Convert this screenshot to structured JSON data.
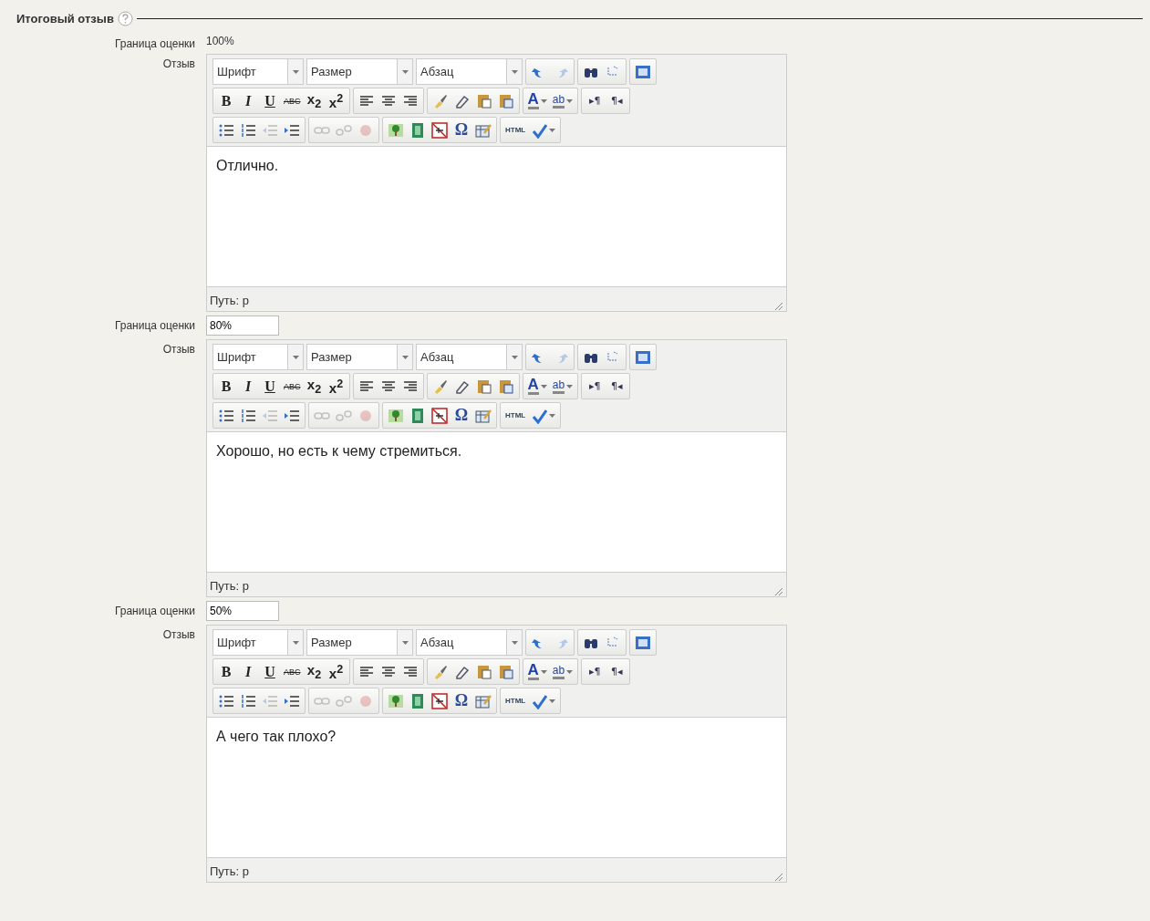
{
  "section": {
    "title": "Итоговый отзыв"
  },
  "entries": [
    {
      "grade": {
        "label": "Граница оценки",
        "value": "100%",
        "editable": false
      },
      "feedback": {
        "label": "Отзыв",
        "text": "Отлично.",
        "path": "Путь: p"
      },
      "toolbar": [
        [
          {
            "kind": "select",
            "label": "Шрифт"
          },
          {
            "kind": "select",
            "label": "Размер"
          },
          {
            "kind": "select",
            "label": "Абзац"
          },
          [
            {
              "kind": "icon",
              "disabled": false
            },
            {
              "kind": "icon",
              "disabled": true
            }
          ],
          [
            {
              "kind": "icon",
              "disabled": false
            },
            {
              "kind": "icon",
              "disabled": false
            }
          ],
          [
            {
              "kind": "icon",
              "disabled": false
            }
          ]
        ],
        [
          [
            {
              "kind": "text",
              "label": "B"
            },
            {
              "kind": "text",
              "label": "I"
            },
            {
              "kind": "text",
              "label": "U"
            },
            {
              "kind": "text",
              "label": "ABC"
            },
            {
              "kind": "text",
              "label": "x$_{2}$"
            },
            {
              "kind": "text",
              "label": "x$^{2}$"
            }
          ],
          [
            {
              "kind": "icon",
              "disabled": false
            },
            {
              "kind": "icon",
              "disabled": false
            },
            {
              "kind": "icon",
              "disabled": false
            }
          ],
          [
            {
              "kind": "icon",
              "disabled": false
            },
            {
              "kind": "icon",
              "disabled": false
            },
            {
              "kind": "icon",
              "disabled": false
            },
            {
              "kind": "icon",
              "disabled": false
            }
          ],
          [
            {
              "kind": "text",
              "label": "A",
              "split": true
            },
            {
              "kind": "text",
              "label": "ab",
              "split": true
            }
          ],
          [
            {
              "kind": "text",
              "label": "▸¶"
            },
            {
              "kind": "text",
              "label": "¶◂"
            }
          ]
        ],
        [
          [
            {
              "kind": "icon",
              "disabled": false
            },
            {
              "kind": "icon",
              "disabled": false
            },
            {
              "kind": "icon",
              "disabled": true
            },
            {
              "kind": "icon",
              "disabled": false
            }
          ],
          [
            {
              "kind": "icon",
              "disabled": true
            },
            {
              "kind": "icon",
              "disabled": true
            },
            {
              "kind": "icon",
              "disabled": true
            }
          ],
          [
            {
              "kind": "icon",
              "disabled": false
            },
            {
              "kind": "icon",
              "disabled": false
            },
            {
              "kind": "icon",
              "disabled": false
            },
            {
              "kind": "text",
              "label": "Ω"
            },
            {
              "kind": "icon",
              "disabled": false
            }
          ],
          [
            {
              "kind": "text",
              "label": "HTML"
            },
            {
              "kind": "icon",
              "disabled": false,
              "split": true
            }
          ]
        ]
      ]
    },
    {
      "grade": {
        "label": "Граница оценки",
        "value": "80%",
        "editable": true
      },
      "feedback": {
        "label": "Отзыв",
        "text": "Хорошо, но есть к чему стремиться.",
        "path": "Путь: p"
      },
      "toolbar": [
        [
          {
            "kind": "select",
            "label": "Шрифт"
          },
          {
            "kind": "select",
            "label": "Размер"
          },
          {
            "kind": "select",
            "label": "Абзац"
          },
          [
            {
              "kind": "icon",
              "disabled": false
            },
            {
              "kind": "icon",
              "disabled": true
            }
          ],
          [
            {
              "kind": "icon",
              "disabled": false
            },
            {
              "kind": "icon",
              "disabled": false
            }
          ],
          [
            {
              "kind": "icon",
              "disabled": false
            }
          ]
        ],
        [
          [
            {
              "kind": "text",
              "label": "B"
            },
            {
              "kind": "text",
              "label": "I"
            },
            {
              "kind": "text",
              "label": "U"
            },
            {
              "kind": "text",
              "label": "ABC"
            },
            {
              "kind": "text",
              "label": "x$_{2}$"
            },
            {
              "kind": "text",
              "label": "x$^{2}$"
            }
          ],
          [
            {
              "kind": "icon",
              "disabled": false
            },
            {
              "kind": "icon",
              "disabled": false
            },
            {
              "kind": "icon",
              "disabled": false
            }
          ],
          [
            {
              "kind": "icon",
              "disabled": false
            },
            {
              "kind": "icon",
              "disabled": false
            },
            {
              "kind": "icon",
              "disabled": false
            },
            {
              "kind": "icon",
              "disabled": false
            }
          ],
          [
            {
              "kind": "text",
              "label": "A",
              "split": true
            },
            {
              "kind": "text",
              "label": "ab",
              "split": true
            }
          ],
          [
            {
              "kind": "text",
              "label": "▸¶"
            },
            {
              "kind": "text",
              "label": "¶◂"
            }
          ]
        ],
        [
          [
            {
              "kind": "icon",
              "disabled": false
            },
            {
              "kind": "icon",
              "disabled": false
            },
            {
              "kind": "icon",
              "disabled": true
            },
            {
              "kind": "icon",
              "disabled": false
            }
          ],
          [
            {
              "kind": "icon",
              "disabled": true
            },
            {
              "kind": "icon",
              "disabled": true
            },
            {
              "kind": "icon",
              "disabled": true
            }
          ],
          [
            {
              "kind": "icon",
              "disabled": false
            },
            {
              "kind": "icon",
              "disabled": false
            },
            {
              "kind": "icon",
              "disabled": false
            },
            {
              "kind": "text",
              "label": "Ω"
            },
            {
              "kind": "icon",
              "disabled": false
            }
          ],
          [
            {
              "kind": "text",
              "label": "HTML"
            },
            {
              "kind": "icon",
              "disabled": false,
              "split": true
            }
          ]
        ]
      ]
    },
    {
      "grade": {
        "label": "Граница оценки",
        "value": "50%",
        "editable": true
      },
      "feedback": {
        "label": "Отзыв",
        "text": "А чего так плохо?",
        "path": "Путь: p"
      },
      "toolbar": [
        [
          {
            "kind": "select",
            "label": "Шрифт"
          },
          {
            "kind": "select",
            "label": "Размер"
          },
          {
            "kind": "select",
            "label": "Абзац"
          },
          [
            {
              "kind": "icon",
              "disabled": false
            },
            {
              "kind": "icon",
              "disabled": true
            }
          ],
          [
            {
              "kind": "icon",
              "disabled": false
            },
            {
              "kind": "icon",
              "disabled": false
            }
          ],
          [
            {
              "kind": "icon",
              "disabled": false
            }
          ]
        ],
        [
          [
            {
              "kind": "text",
              "label": "B"
            },
            {
              "kind": "text",
              "label": "I"
            },
            {
              "kind": "text",
              "label": "U"
            },
            {
              "kind": "text",
              "label": "ABC"
            },
            {
              "kind": "text",
              "label": "x$_{2}$"
            },
            {
              "kind": "text",
              "label": "x$^{2}$"
            }
          ],
          [
            {
              "kind": "icon",
              "disabled": false
            },
            {
              "kind": "icon",
              "disabled": false
            },
            {
              "kind": "icon",
              "disabled": false
            }
          ],
          [
            {
              "kind": "icon",
              "disabled": false
            },
            {
              "kind": "icon",
              "disabled": false
            },
            {
              "kind": "icon",
              "disabled": false
            },
            {
              "kind": "icon",
              "disabled": false
            }
          ],
          [
            {
              "kind": "text",
              "label": "A",
              "split": true
            },
            {
              "kind": "text",
              "label": "ab",
              "split": true
            }
          ],
          [
            {
              "kind": "text",
              "label": "▸¶"
            },
            {
              "kind": "text",
              "label": "¶◂"
            }
          ]
        ],
        [
          [
            {
              "kind": "icon",
              "disabled": false
            },
            {
              "kind": "icon",
              "disabled": false
            },
            {
              "kind": "icon",
              "disabled": true
            },
            {
              "kind": "icon",
              "disabled": false
            }
          ],
          [
            {
              "kind": "icon",
              "disabled": true
            },
            {
              "kind": "icon",
              "disabled": true
            },
            {
              "kind": "icon",
              "disabled": true
            }
          ],
          [
            {
              "kind": "icon",
              "disabled": false
            },
            {
              "kind": "icon",
              "disabled": false
            },
            {
              "kind": "icon",
              "disabled": false
            },
            {
              "kind": "text",
              "label": "Ω"
            },
            {
              "kind": "icon",
              "disabled": false
            }
          ],
          [
            {
              "kind": "text",
              "label": "HTML"
            },
            {
              "kind": "icon",
              "disabled": false,
              "split": true
            }
          ]
        ]
      ]
    }
  ]
}
